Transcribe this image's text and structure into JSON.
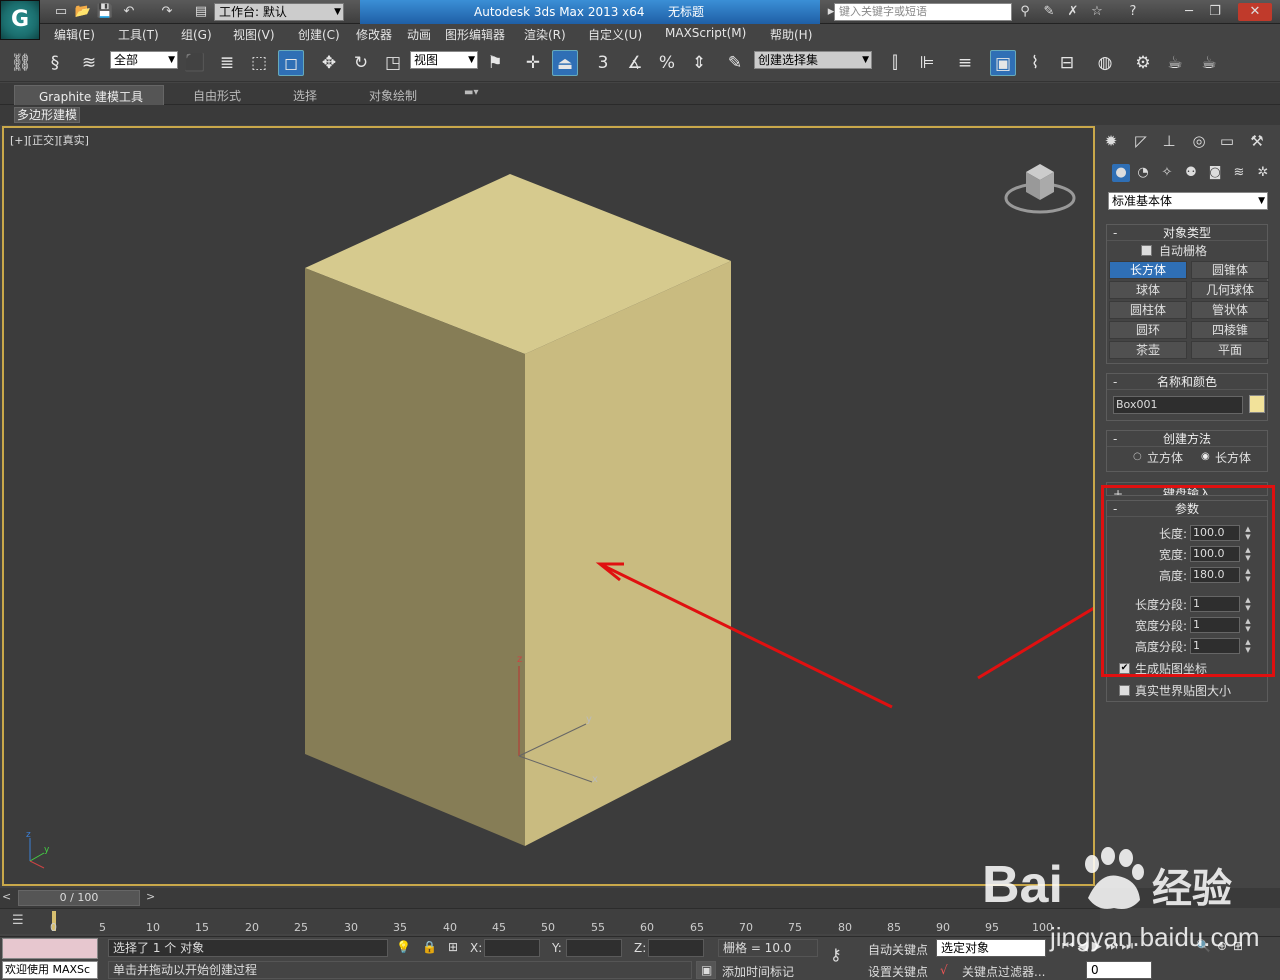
{
  "titlebar": {
    "workspace": "工作台: 默认",
    "app_title": "Autodesk 3ds Max  2013 x64",
    "doc_title": "无标题",
    "search_placeholder": "键入关键字或短语"
  },
  "menu": [
    "编辑(E)",
    "工具(T)",
    "组(G)",
    "视图(V)",
    "创建(C)",
    "修改器",
    "动画",
    "图形编辑器",
    "渲染(R)",
    "自定义(U)",
    "MAXScript(M)",
    "帮助(H)"
  ],
  "toolbar": {
    "filter_value": "全部",
    "refcoord_value": "视图",
    "snap_3": "3",
    "snap_pct": "%",
    "selection_set": "创建选择集"
  },
  "ribbon": {
    "tabs": [
      "Graphite 建模工具",
      "自由形式",
      "选择",
      "对象绘制"
    ],
    "subtab": "多边形建模"
  },
  "viewport": {
    "label": "[+][正交][真实]",
    "axis_z": "z",
    "axis_y": "y",
    "axis_x": "x",
    "box_color": "#d4c78a"
  },
  "command_panel": {
    "category": "标准基本体",
    "object_type": {
      "title": "对象类型",
      "autogrid": "自动栅格",
      "buttons": [
        "长方体",
        "圆锥体",
        "球体",
        "几何球体",
        "圆柱体",
        "管状体",
        "圆环",
        "四棱锥",
        "茶壶",
        "平面"
      ],
      "active": "长方体"
    },
    "name_color": {
      "title": "名称和颜色",
      "name": "Box001",
      "swatch": "#f2e29a"
    },
    "creation_method": {
      "title": "创建方法",
      "options": [
        "立方体",
        "长方体"
      ],
      "selected": "长方体"
    },
    "keyboard_entry": {
      "title": "键盘输入"
    },
    "parameters": {
      "title": "参数",
      "length_label": "长度:",
      "length": "100.0",
      "width_label": "宽度:",
      "width": "100.0",
      "height_label": "高度:",
      "height": "180.0",
      "len_segs_label": "长度分段:",
      "len_segs": "1",
      "wid_segs_label": "宽度分段:",
      "wid_segs": "1",
      "hgt_segs_label": "高度分段:",
      "hgt_segs": "1",
      "gen_mapping": "生成贴图坐标",
      "real_world": "真实世界贴图大小"
    }
  },
  "timeline": {
    "frame": "0 / 100",
    "ticks": [
      "0",
      "5",
      "10",
      "15",
      "20",
      "25",
      "30",
      "35",
      "40",
      "45",
      "50",
      "55",
      "60",
      "65",
      "70",
      "75",
      "80",
      "85",
      "90",
      "95",
      "100"
    ]
  },
  "status": {
    "welcome": "欢迎使用 MAXSc",
    "selected": "选择了 1 个 对象",
    "prompt": "单击并拖动以开始创建过程",
    "x_label": "X:",
    "y_label": "Y:",
    "z_label": "Z:",
    "grid": "栅格 = 10.0",
    "auto_key": "自动关键点",
    "set_key": "设置关键点",
    "selected_obj": "选定对象",
    "key_filter": "关键点过滤器...",
    "add_time_tag": "添加时间标记",
    "frame_field": "0"
  },
  "watermark": {
    "brand": "Bai",
    "brand2": "经验",
    "url": "jingyan.baidu.com"
  },
  "annotation_color": "#e01010"
}
